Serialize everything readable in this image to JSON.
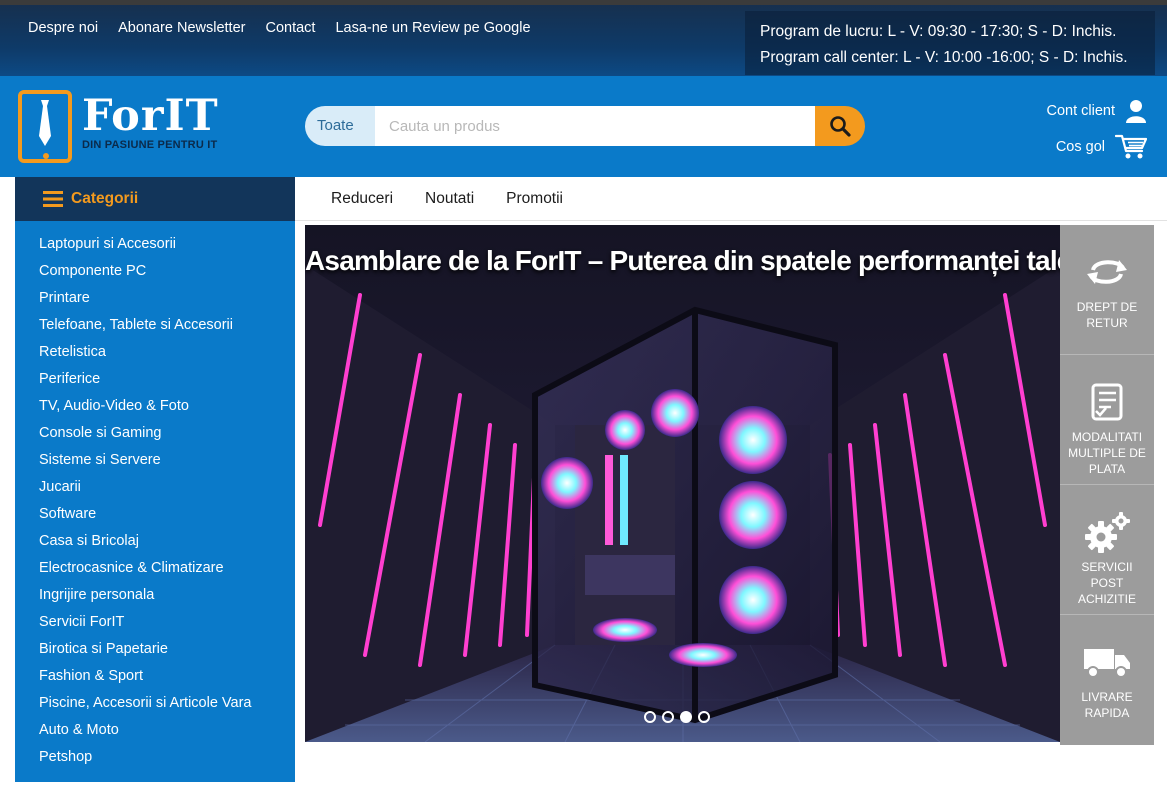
{
  "topbar": {
    "links": [
      "Despre noi",
      "Abonare Newsletter",
      "Contact",
      "Lasa-ne un Review pe Google"
    ],
    "hours_work": "Program de lucru: L - V: 09:30 - 17:30; S - D: Inchis.",
    "hours_callcenter": "Program call center: L - V: 10:00 -16:00; S - D: Inchis."
  },
  "header": {
    "logo_name": "ForIT",
    "logo_tagline": "DIN PASIUNE PENTRU IT",
    "search_category": "Toate",
    "search_placeholder": "Cauta un produs",
    "account_label": "Cont client",
    "cart_label": "Cos gol"
  },
  "nav": {
    "categories_label": "Categorii",
    "links": [
      "Reduceri",
      "Noutati",
      "Promotii"
    ]
  },
  "sidebar": {
    "items": [
      "Laptopuri si Accesorii",
      "Componente PC",
      "Printare",
      "Telefoane, Tablete si Accesorii",
      "Retelistica",
      "Periferice",
      "TV, Audio-Video & Foto",
      "Console si Gaming",
      "Sisteme si Servere",
      "Jucarii",
      "Software",
      "Casa si Bricolaj",
      "Electrocasnice & Climatizare",
      "Ingrijire personala",
      "Servicii ForIT",
      "Birotica si Papetarie",
      "Fashion & Sport",
      "Piscine, Accesorii si Articole Vara",
      "Auto & Moto",
      "Petshop"
    ]
  },
  "banner": {
    "title": "Asamblare de la ForIT – Puterea din spatele performanței tale!",
    "slide_count": 4,
    "active_slide": 3
  },
  "features": [
    {
      "label": "DREPT DE RETUR",
      "icon": "return-arrows-icon"
    },
    {
      "label": "MODALITATI MULTIPLE DE PLATA",
      "icon": "payment-list-icon"
    },
    {
      "label": "SERVICII POST ACHIZITIE",
      "icon": "gears-icon"
    },
    {
      "label": "LIVRARE RAPIDA",
      "icon": "truck-icon"
    }
  ],
  "colors": {
    "brand_blue": "#0a7ac9",
    "accent_orange": "#f39a1e",
    "dark_navy": "#12355a",
    "feature_gray": "#9c9c9c"
  }
}
